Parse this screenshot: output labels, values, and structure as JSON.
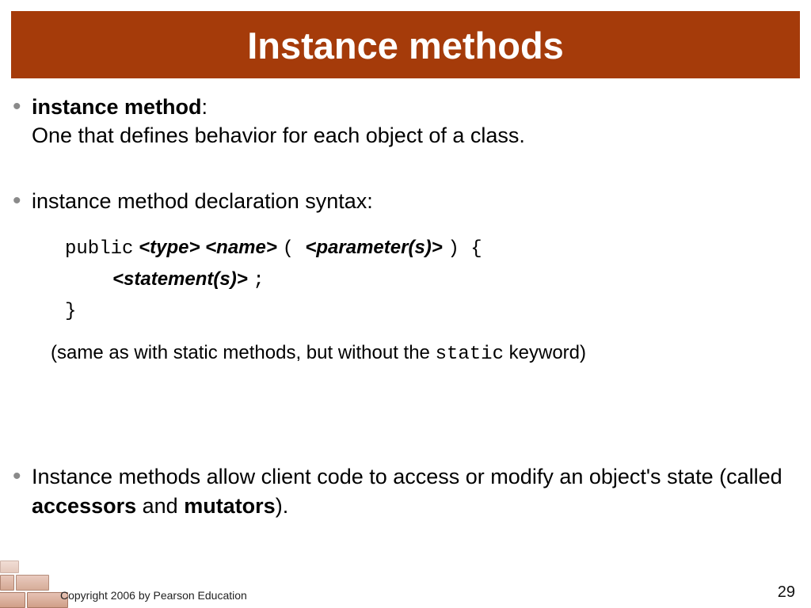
{
  "title": "Instance methods",
  "bullets": {
    "b1_term": "instance method",
    "b1_colon": ":",
    "b1_def": "One that defines behavior for each object of a class.",
    "b2_text": "instance method declaration syntax:",
    "code": {
      "l1_public": "public",
      "l1_type": "<type>",
      "l1_name": "<name>",
      "l1_open": " ( ",
      "l1_params": "<parameter(s)>",
      "l1_close": " ) {",
      "l2_stmts": "<statement(s)>",
      "l2_semi": " ;",
      "l3_brace": "}"
    },
    "note_pre": "(same as with static methods, but without the ",
    "note_kw": "static",
    "note_post": " keyword)",
    "b3_pre": "Instance methods allow client code to access or modify an object's state (called ",
    "b3_acc": "accessors",
    "b3_and": " and ",
    "b3_mut": "mutators",
    "b3_post": ")."
  },
  "footer": {
    "copyright": "Copyright 2006 by Pearson Education",
    "page": "29"
  }
}
